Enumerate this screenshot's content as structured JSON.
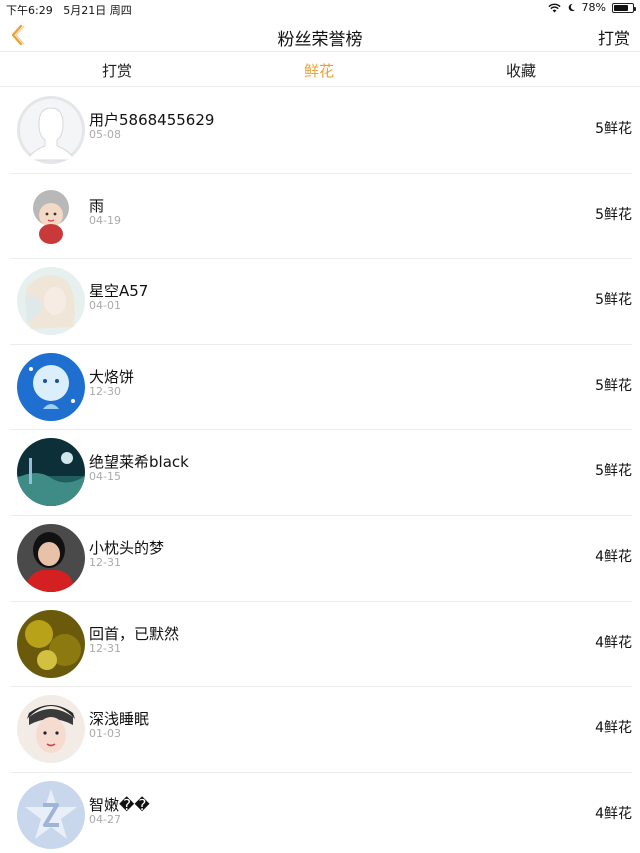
{
  "status_bar": {
    "time": "下午6:29",
    "date": "5月21日 周四",
    "battery_text": "78%",
    "battery_level": 0.78
  },
  "nav": {
    "title": "粉丝荣誉榜",
    "right_button": "打赏",
    "back_icon": "chevron-left-icon",
    "accent_color": "#e9a23b"
  },
  "tabs": [
    {
      "label": "打赏",
      "active": false
    },
    {
      "label": "鲜花",
      "active": true
    },
    {
      "label": "收藏",
      "active": false
    }
  ],
  "fans": [
    {
      "name": "用户5868455629",
      "date": "05-08",
      "count": "5鲜花"
    },
    {
      "name": "雨",
      "date": "04-19",
      "count": "5鲜花"
    },
    {
      "name": "星空A57",
      "date": "04-01",
      "count": "5鲜花"
    },
    {
      "name": "大烙饼",
      "date": "12-30",
      "count": "5鲜花"
    },
    {
      "name": "绝望莱希black",
      "date": "04-15",
      "count": "5鲜花"
    },
    {
      "name": "小枕头的梦",
      "date": "12-31",
      "count": "4鲜花"
    },
    {
      "name": "回首，已默然",
      "date": "12-31",
      "count": "4鲜花"
    },
    {
      "name": "深浅睡眠",
      "date": "01-03",
      "count": "4鲜花"
    },
    {
      "name": "智嫩��",
      "date": "04-27",
      "count": "4鲜花"
    }
  ]
}
